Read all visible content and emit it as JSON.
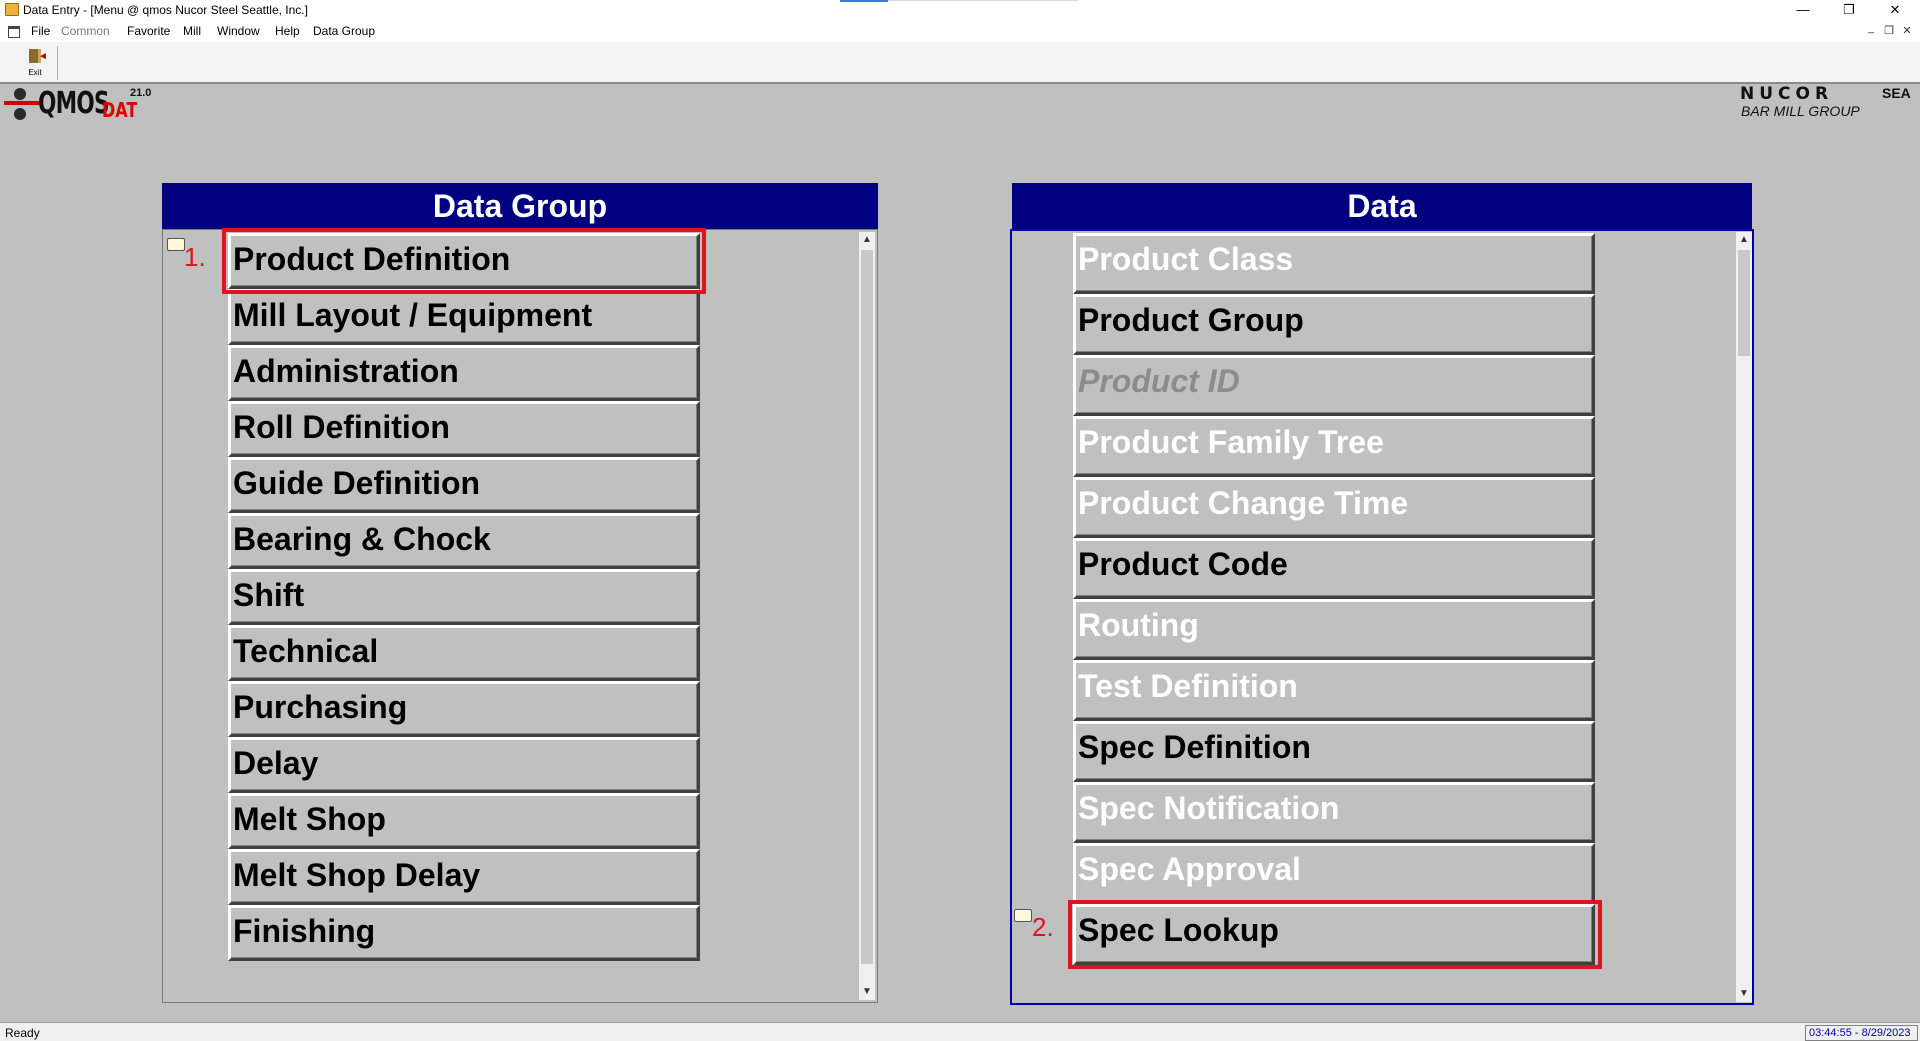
{
  "window": {
    "title": "Data Entry - [Menu  @ qmos Nucor Steel Seattle, Inc.]",
    "min_glyph": "—",
    "max_glyph": "❐",
    "close_glyph": "✕"
  },
  "menubar": {
    "items": [
      "File",
      "Common",
      "Favorite",
      "Mill",
      "Window",
      "Help",
      "Data Group"
    ],
    "mdi_controls": [
      "_",
      "❐",
      "✕"
    ]
  },
  "toolbar": {
    "exit_label": "Exit",
    "exit_icon": "exit-door-icon"
  },
  "header": {
    "logo_text": "QMOS",
    "logo_dat": "DAT",
    "logo_version": "21.0",
    "company": "NUCOR",
    "site": "SEA",
    "group": "BAR MILL  GROUP"
  },
  "left_panel": {
    "title": "Data Group",
    "step_label": "1.",
    "items": [
      "Product Definition",
      "Mill Layout / Equipment",
      "Administration",
      "Roll Definition",
      "Guide Definition",
      "Bearing & Chock",
      "Shift",
      "Technical",
      "Purchasing",
      "Delay",
      "Melt Shop",
      "Melt Shop Delay",
      "Finishing"
    ]
  },
  "right_panel": {
    "title": "Data",
    "step_label": "2.",
    "items": [
      {
        "label": "Product Class",
        "state": "inactive"
      },
      {
        "label": "Product Group",
        "state": "active"
      },
      {
        "label": "Product ID",
        "state": "italic"
      },
      {
        "label": "Product Family Tree",
        "state": "inactive"
      },
      {
        "label": "Product Change Time",
        "state": "inactive"
      },
      {
        "label": "Product Code",
        "state": "active"
      },
      {
        "label": "Routing",
        "state": "inactive"
      },
      {
        "label": "Test Definition",
        "state": "inactive"
      },
      {
        "label": "Spec Definition",
        "state": "active"
      },
      {
        "label": "Spec Notification",
        "state": "inactive"
      },
      {
        "label": "Spec Approval",
        "state": "inactive"
      },
      {
        "label": "Spec Lookup",
        "state": "active"
      }
    ]
  },
  "status": {
    "text": "Ready",
    "clock": "03:44:55 - 8/29/2023"
  },
  "colors": {
    "highlight": "#e0141e",
    "panel_header": "#000080",
    "background": "#c0c0c0"
  }
}
